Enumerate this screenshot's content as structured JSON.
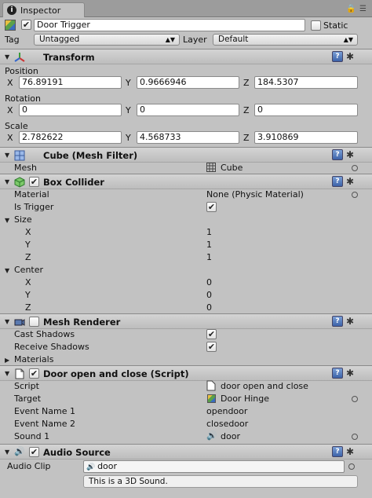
{
  "window": {
    "tab_label": "Inspector"
  },
  "gameobject": {
    "name": "Door Trigger",
    "static_label": "Static",
    "tag_label": "Tag",
    "tag_value": "Untagged",
    "layer_label": "Layer",
    "layer_value": "Default"
  },
  "transform": {
    "title": "Transform",
    "position_label": "Position",
    "rotation_label": "Rotation",
    "scale_label": "Scale",
    "axes": [
      "X",
      "Y",
      "Z"
    ],
    "position": [
      "76.89191",
      "0.9666946",
      "184.5307"
    ],
    "rotation": [
      "0",
      "0",
      "0"
    ],
    "scale": [
      "2.782622",
      "4.568733",
      "3.910869"
    ]
  },
  "mesh_filter": {
    "title": "Cube (Mesh Filter)",
    "mesh_label": "Mesh",
    "mesh_value": "Cube"
  },
  "box_collider": {
    "title": "Box Collider",
    "material_label": "Material",
    "material_value": "None (Physic Material)",
    "is_trigger_label": "Is Trigger",
    "size_label": "Size",
    "size": [
      "1",
      "1",
      "1"
    ],
    "center_label": "Center",
    "center": [
      "0",
      "0",
      "0"
    ],
    "axes": [
      "X",
      "Y",
      "Z"
    ]
  },
  "mesh_renderer": {
    "title": "Mesh Renderer",
    "cast_shadows_label": "Cast Shadows",
    "receive_shadows_label": "Receive Shadows",
    "materials_label": "Materials"
  },
  "script_component": {
    "title": "Door open and close (Script)",
    "script_label": "Script",
    "script_value": "door open and close",
    "target_label": "Target",
    "target_value": "Door Hinge",
    "event1_label": "Event Name 1",
    "event1_value": "opendoor",
    "event2_label": "Event Name 2",
    "event2_value": "closedoor",
    "sound1_label": "Sound 1",
    "sound1_value": "door"
  },
  "audio_source": {
    "title": "Audio Source",
    "clip_label": "Audio Clip",
    "clip_value": "door",
    "info_text": "This is a 3D Sound."
  },
  "icons": {
    "help": "?",
    "gear": "✱",
    "checkmark": "✔",
    "info": "i"
  }
}
